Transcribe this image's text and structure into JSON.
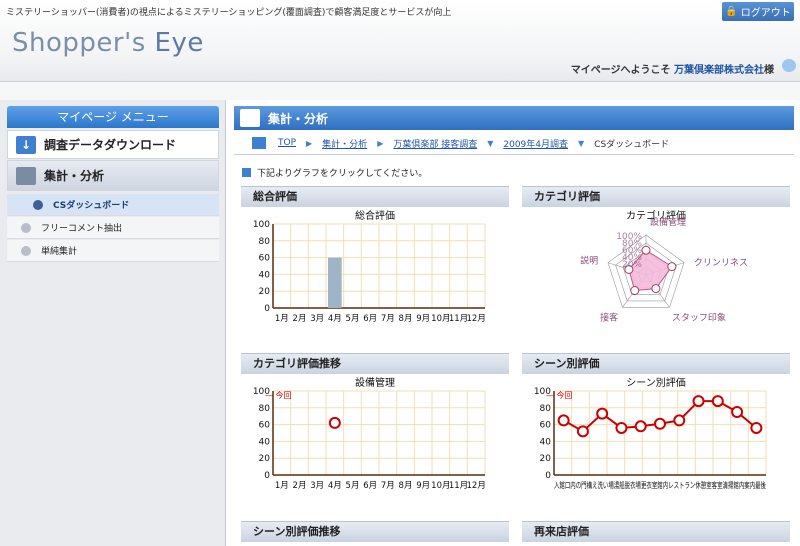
{
  "header": {
    "tagline": "ミステリーショッパー(消費者)の視点によるミステリーショッピング(覆面調査)で顧客満足度とサービスが向上",
    "logout_label": "ログアウト",
    "logo_text_a": "Shopper's ",
    "logo_text_b": "Eye",
    "welcome_prefix": "マイページへようこそ ",
    "company": "万葉倶楽部株式会社",
    "welcome_suffix": "様"
  },
  "sidebar": {
    "title": "マイページ メニュー",
    "download_label": "調査データダウンロード",
    "aggregate_label": "集計・分析",
    "sub_items": [
      "CSダッシュボード",
      "フリーコメント抽出",
      "単純集計"
    ]
  },
  "main": {
    "page_title": "集計・分析",
    "breadcrumbs": [
      "TOP",
      "集計・分析",
      "万葉倶楽部 接客調査",
      "2009年4月調査",
      "CSダッシュボード"
    ],
    "instruction": "下記よりグラフをクリックしてください。",
    "panels": [
      "総合評価",
      "カテゴリ評価",
      "カテゴリ評価推移",
      "シーン別評価",
      "シーン別評価推移",
      "再来店評価"
    ]
  },
  "colors": {
    "accent": "#2e6fbf",
    "bar": "#9fb4c7",
    "line": "#cc0000",
    "radar_fill": "#f4b6d8",
    "grid": "#f3deb0"
  },
  "chart_data": [
    {
      "type": "bar",
      "title": "総合評価",
      "categories": [
        "1月",
        "2月",
        "3月",
        "4月",
        "5月",
        "6月",
        "7月",
        "8月",
        "9月",
        "10月",
        "11月",
        "12月"
      ],
      "values": [
        null,
        null,
        null,
        60,
        null,
        null,
        null,
        null,
        null,
        null,
        null,
        null
      ],
      "ylim": [
        0,
        100
      ],
      "yticks": [
        0,
        20,
        40,
        60,
        80,
        100
      ]
    },
    {
      "type": "radar",
      "title": "カテゴリ評価",
      "axes": [
        "設備管理",
        "クリンリネス",
        "スタッフ印象",
        "接客",
        "説明"
      ],
      "values": [
        62,
        68,
        42,
        48,
        45
      ],
      "rings": [
        "100%",
        "80%",
        "60%",
        "40%",
        "20%"
      ]
    },
    {
      "type": "line",
      "title": "設備管理",
      "legend": "今回",
      "categories": [
        "1月",
        "2月",
        "3月",
        "4月",
        "5月",
        "6月",
        "7月",
        "8月",
        "9月",
        "10月",
        "11月",
        "12月"
      ],
      "values": [
        null,
        null,
        null,
        62,
        null,
        null,
        null,
        null,
        null,
        null,
        null,
        null
      ],
      "ylim": [
        0,
        100
      ],
      "yticks": [
        0,
        20,
        40,
        60,
        80,
        100
      ]
    },
    {
      "type": "line",
      "title": "シーン別評価",
      "legend": "今回",
      "categories_label": "入館口内の門構え洗い場湯船脱衣場更衣室館内レストラン休憩室客室清掃館内案内最後",
      "values": [
        65,
        52,
        73,
        56,
        58,
        61,
        65,
        88,
        88,
        75,
        56
      ],
      "ylim": [
        0,
        100
      ],
      "yticks": [
        0,
        20,
        40,
        60,
        80,
        100
      ]
    }
  ]
}
